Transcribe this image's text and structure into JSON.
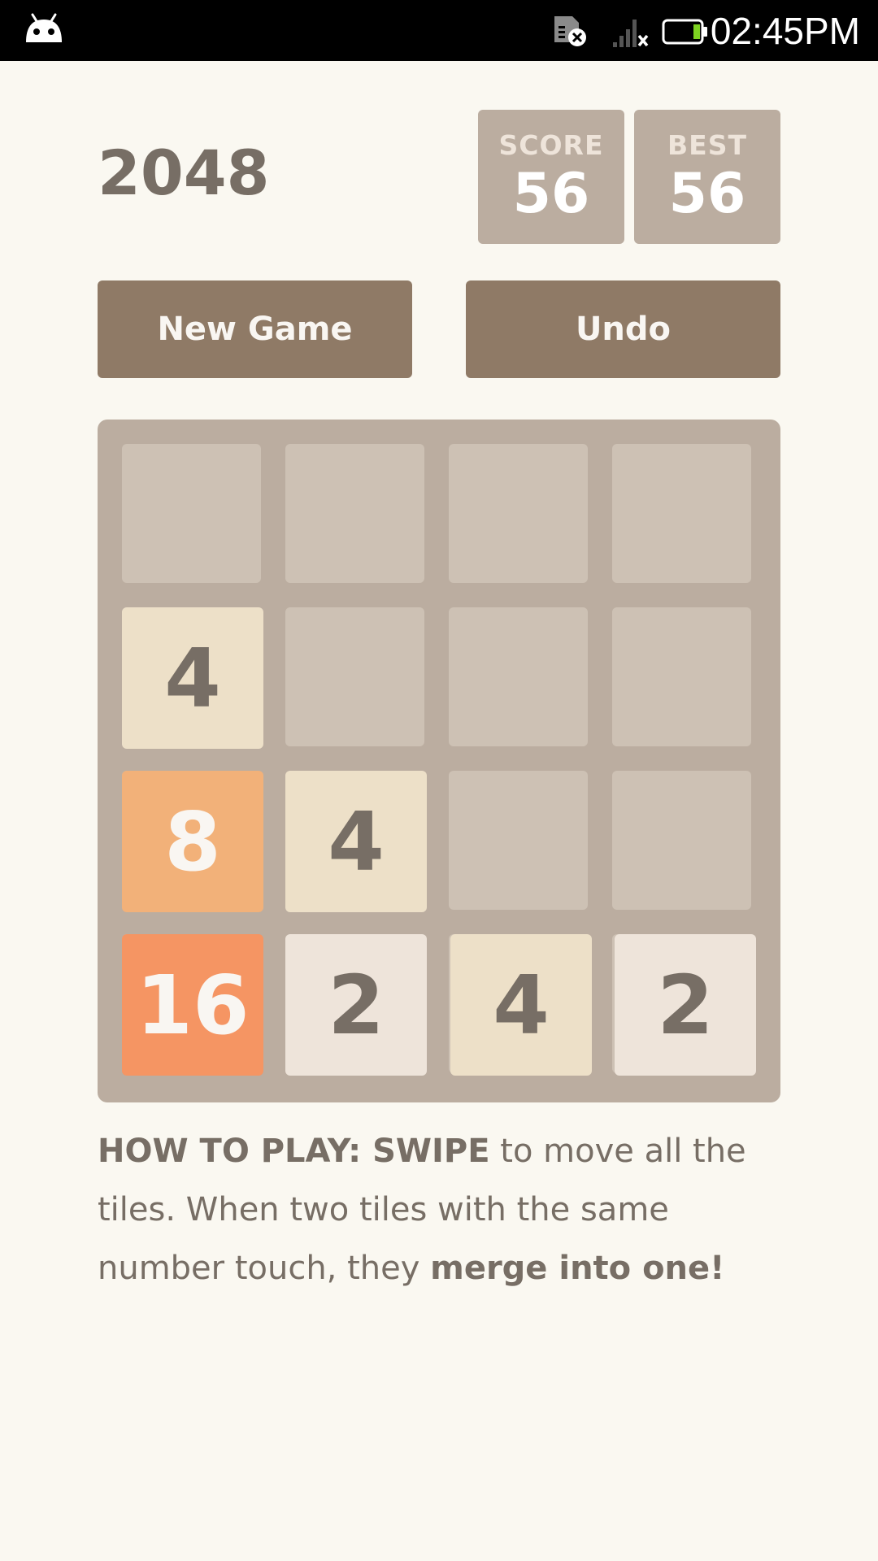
{
  "status_bar": {
    "time": "02:45PM",
    "icons": [
      "android-icon",
      "sim-card-error-icon",
      "no-signal-icon",
      "battery-icon"
    ]
  },
  "game": {
    "title": "2048",
    "score_label": "SCORE",
    "score": "56",
    "best_label": "BEST",
    "best": "56"
  },
  "buttons": {
    "new_game": "New Game",
    "undo": "Undo"
  },
  "board": {
    "rows": [
      [
        "",
        "",
        "",
        ""
      ],
      [
        "4",
        "",
        "",
        ""
      ],
      [
        "8",
        "4",
        "",
        ""
      ],
      [
        "16",
        "2",
        "4",
        "2"
      ]
    ]
  },
  "instructions": {
    "bold_lead": "HOW TO PLAY: SWIPE",
    "middle": " to move all the tiles. When two tiles with the same number touch, they ",
    "bold_tail": "merge into one!"
  },
  "colors": {
    "background": "#faf8f1",
    "board": "#bbada0",
    "empty_cell": "#cdc1b4",
    "tile_2": "#eee4da",
    "tile_4": "#ede0c8",
    "tile_8": "#f2b179",
    "tile_16": "#f59563",
    "button": "#8f7a66",
    "text_dark": "#776e65"
  }
}
